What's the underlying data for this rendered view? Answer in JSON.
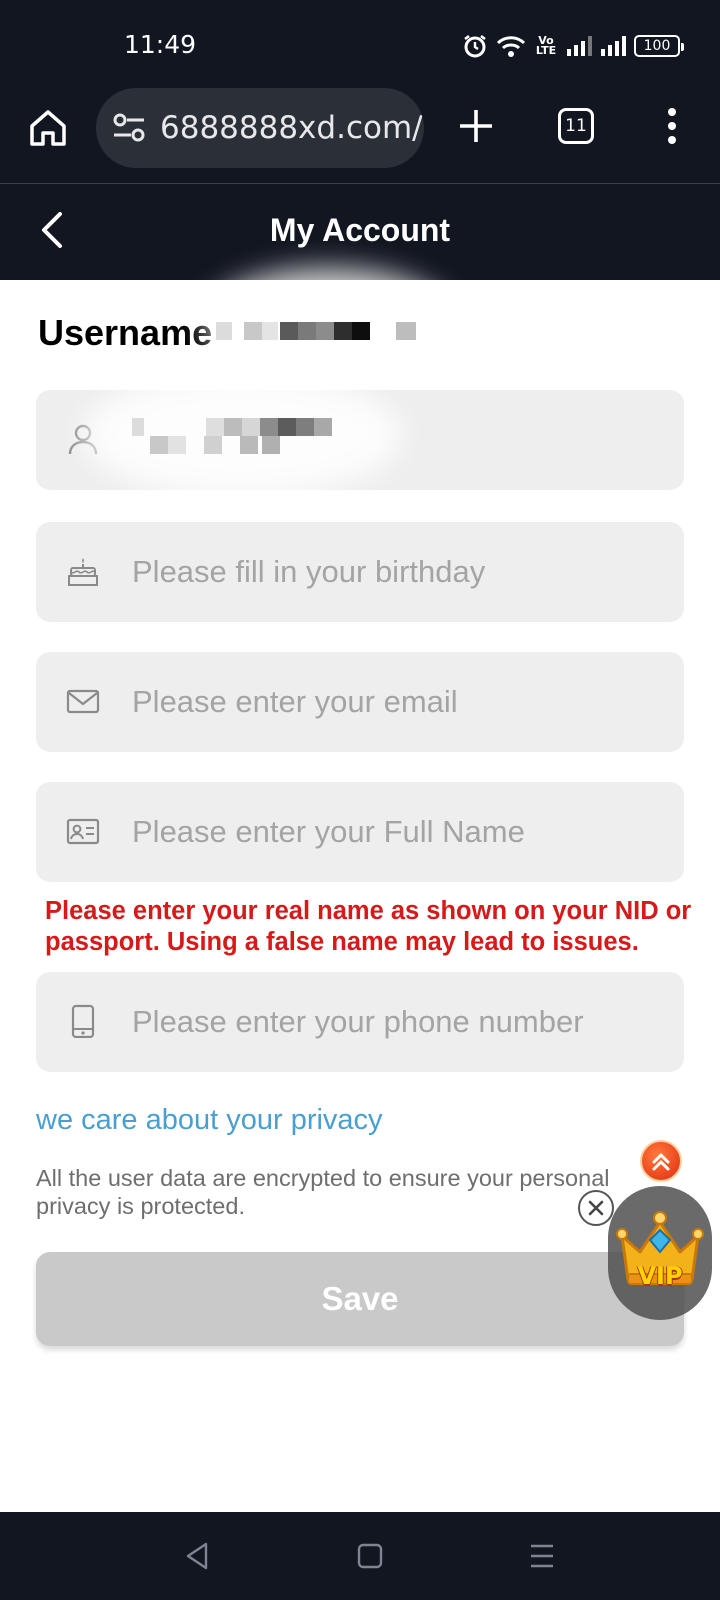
{
  "status_bar": {
    "time": "11:49",
    "network": "Vo\nLTE",
    "battery": "100"
  },
  "browser": {
    "url": "6888888xd.com/",
    "tab_count": "11"
  },
  "header": {
    "title": "My Account"
  },
  "form": {
    "username_label": "Username",
    "fields": [
      {
        "icon": "user-icon",
        "placeholder": "",
        "value": ""
      },
      {
        "icon": "cake-icon",
        "placeholder": "Please fill in your birthday",
        "value": ""
      },
      {
        "icon": "mail-icon",
        "placeholder": "Please enter your email",
        "value": ""
      },
      {
        "icon": "id-card-icon",
        "placeholder": "Please enter your Full Name",
        "value": ""
      },
      {
        "icon": "phone-icon",
        "placeholder": "Please enter your phone number",
        "value": ""
      }
    ],
    "fullname_warning": "Please enter your real name as shown on your NID or passport. Using a false name may lead to issues.",
    "save_label": "Save"
  },
  "privacy": {
    "title": "we care about your privacy",
    "description": "All the user data are encrypted to ensure your personal privacy is protected."
  },
  "widgets": {
    "vip_label": "VIP"
  },
  "colors": {
    "bar_bg": "#121621",
    "field_bg": "#eeeeee",
    "warning": "#d61a1a",
    "link": "#4a9fd2",
    "save_disabled": "#c9c9c9"
  }
}
